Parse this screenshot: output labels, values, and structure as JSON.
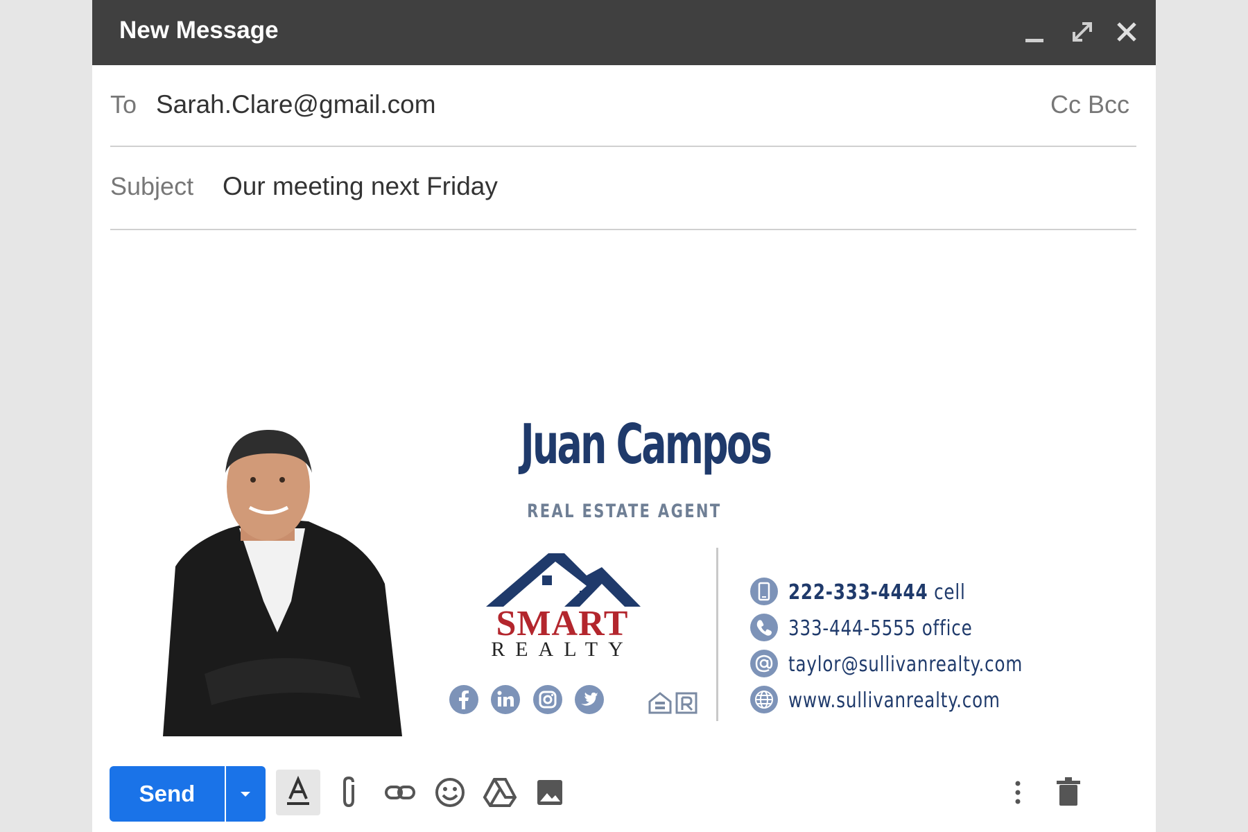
{
  "window": {
    "title": "New Message",
    "controls": {
      "minimize_icon": "minimize-icon",
      "expand_icon": "expand-icon",
      "close_icon": "close-icon"
    }
  },
  "to": {
    "label": "To",
    "value": "Sarah.Clare@gmail.com",
    "cc_bcc": "Cc Bcc"
  },
  "subject": {
    "label": "Subject",
    "value": "Our meeting next Friday"
  },
  "signature": {
    "name": "Juan Campos",
    "role": "REAL ESTATE AGENT",
    "logo": {
      "word1": "SMART",
      "word2": "REALTY"
    },
    "social": [
      "facebook-icon",
      "linkedin-icon",
      "instagram-icon",
      "twitter-icon"
    ],
    "contacts": [
      {
        "icon": "phone-mobile-icon",
        "value": "222-333-4444",
        "suffix": "cell"
      },
      {
        "icon": "phone-office-icon",
        "value": "333-444-5555",
        "suffix": "office"
      },
      {
        "icon": "email-icon",
        "value": "taylor@sullivanrealty.com",
        "suffix": ""
      },
      {
        "icon": "globe-icon",
        "value": "www.sullivanrealty.com",
        "suffix": ""
      }
    ],
    "colors": {
      "navy": "#1f3a6b",
      "grey_blue": "#6f7f95",
      "red": "#b3262d",
      "icon_blue": "#7d93b8"
    }
  },
  "toolbar": {
    "send_label": "Send",
    "tools": [
      "formatting-icon",
      "attach-icon",
      "link-icon",
      "emoji-icon",
      "drive-icon",
      "photo-icon",
      "more-options-icon",
      "discard-icon"
    ]
  },
  "colors": {
    "titlebar": "#404040",
    "send": "#1a73e8",
    "background": "#e6e6e6"
  }
}
